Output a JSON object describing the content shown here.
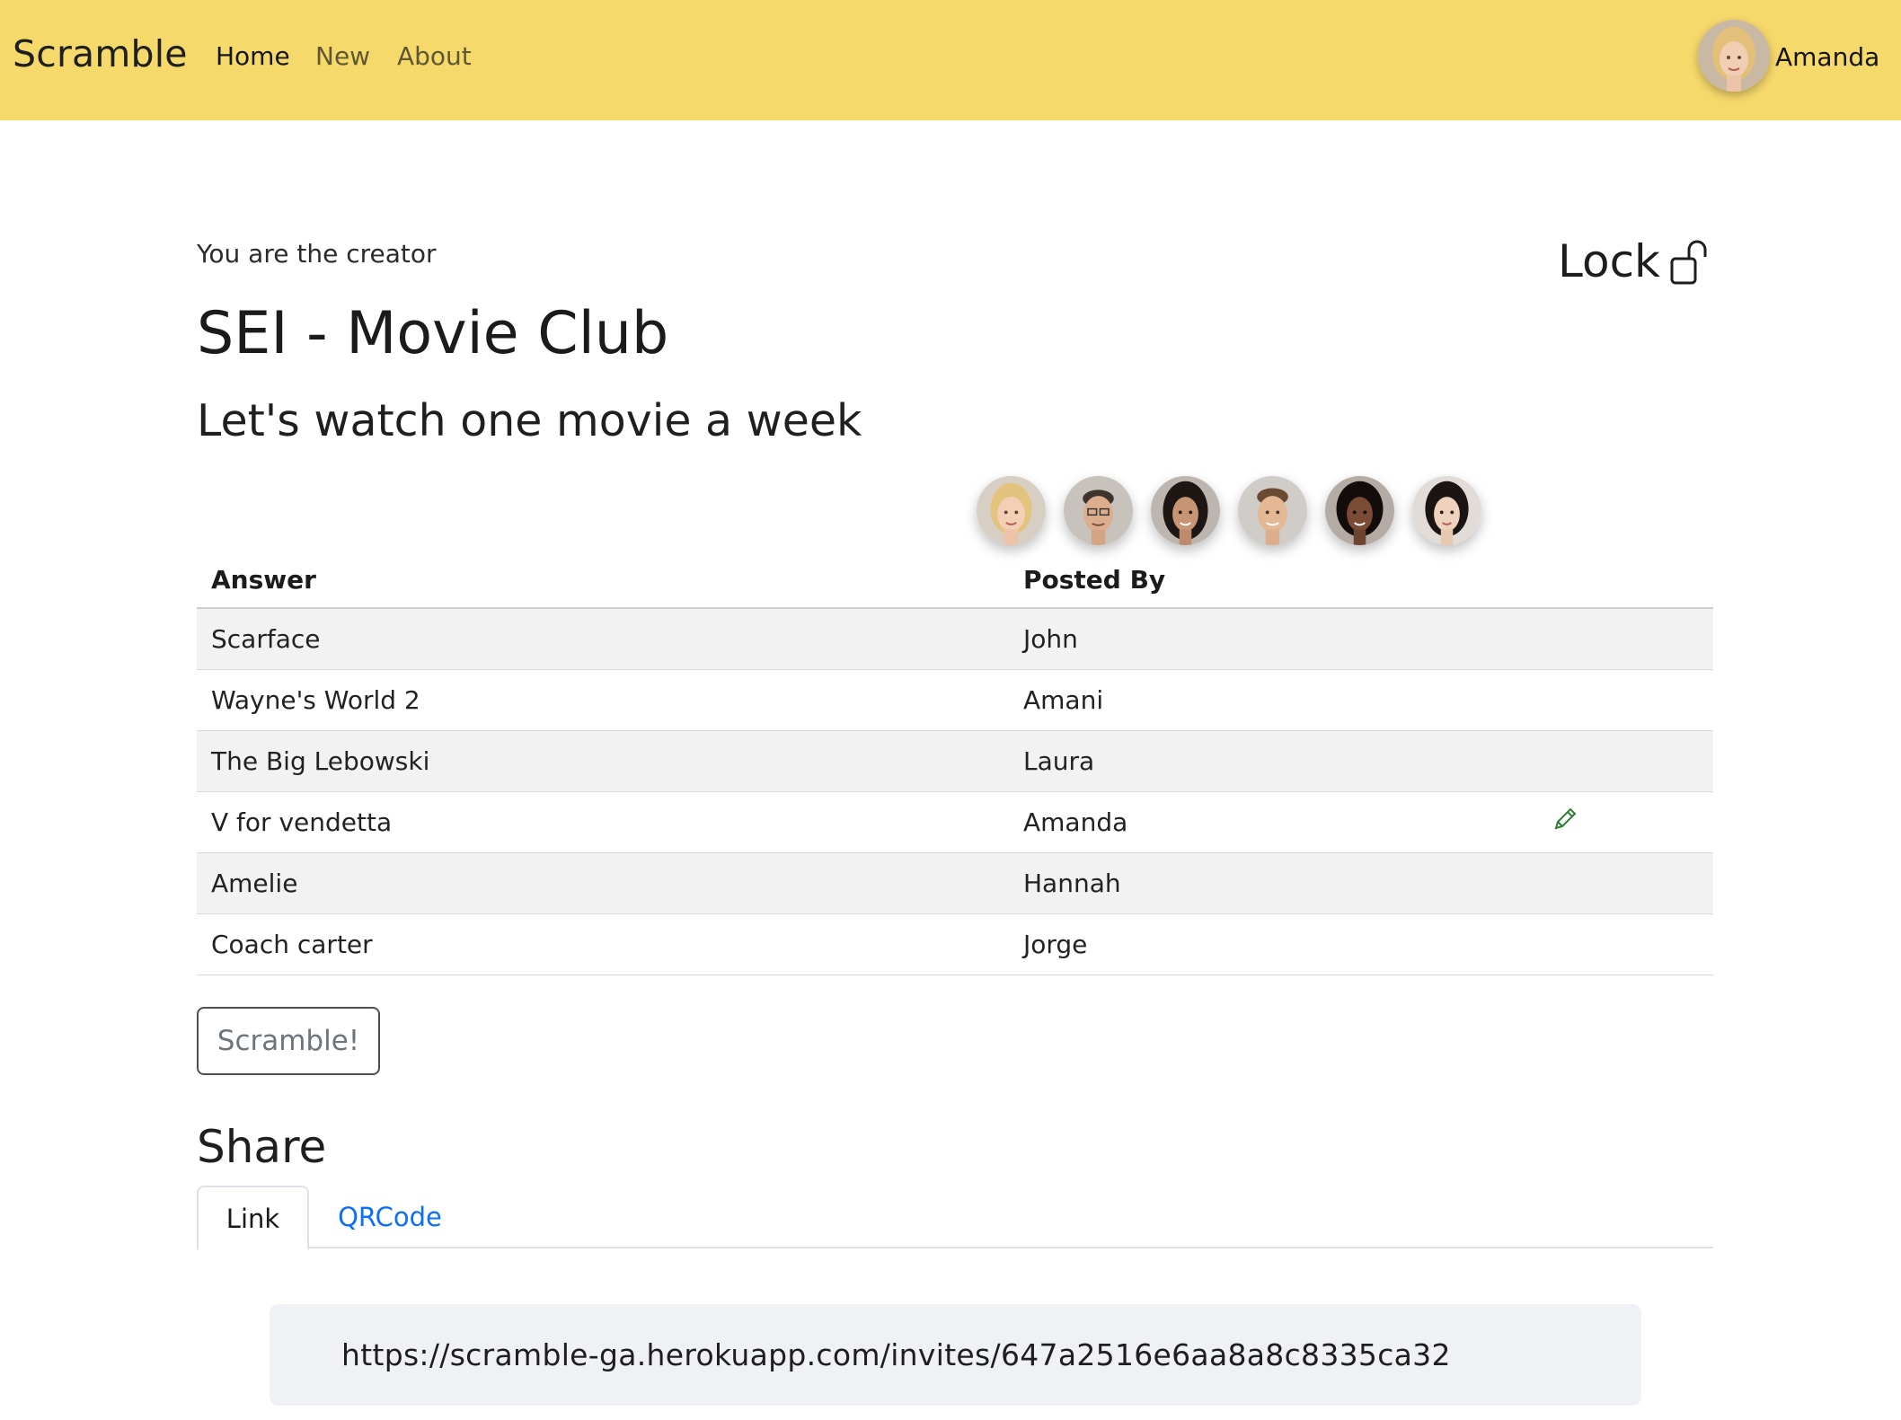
{
  "navbar": {
    "brand": "Scramble",
    "links": [
      {
        "label": "Home"
      },
      {
        "label": "New"
      },
      {
        "label": "About"
      }
    ],
    "user_name": "Amanda",
    "background": "#f6d96b"
  },
  "header": {
    "creator_note": "You are the creator",
    "lock_label": "Lock",
    "lock_icon": "unlocked-padlock-icon",
    "title": "SEI - Movie Club",
    "subtitle": "Let's watch one movie a week"
  },
  "members": [
    "member-avatar",
    "member-avatar",
    "member-avatar",
    "member-avatar",
    "member-avatar",
    "member-avatar"
  ],
  "table": {
    "headers": [
      "Answer",
      "Posted By"
    ],
    "rows": [
      {
        "answer": "Scarface",
        "posted_by": "John"
      },
      {
        "answer": "Wayne's World 2",
        "posted_by": "Amani"
      },
      {
        "answer": "The Big Lebowski",
        "posted_by": "Laura"
      },
      {
        "answer": "V for vendetta",
        "posted_by": "Amanda",
        "editable": true
      },
      {
        "answer": "Amelie",
        "posted_by": "Hannah"
      },
      {
        "answer": "Coach carter",
        "posted_by": "Jorge"
      }
    ]
  },
  "scramble_button": "Scramble!",
  "share": {
    "heading": "Share",
    "tabs": [
      {
        "label": "Link",
        "active": true
      },
      {
        "label": "QRCode",
        "active": false
      }
    ],
    "invite_url": "https://scramble-ga.herokuapp.com/invites/647a2516e6aa8a8c8335ca32"
  },
  "colors": {
    "accent_link": "#0d6efd",
    "edit_icon": "#2e7d32"
  }
}
